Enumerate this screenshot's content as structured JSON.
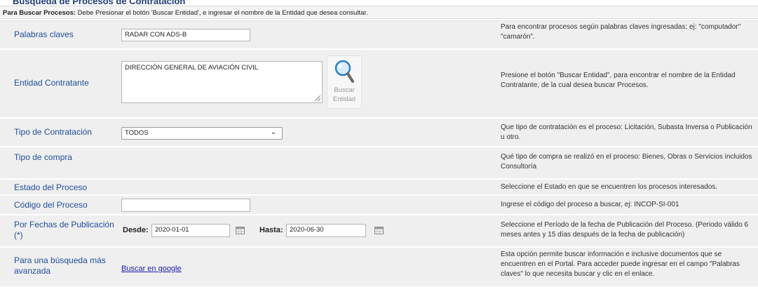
{
  "page_title": "Búsqueda de Procesos de Contratación",
  "instructions": {
    "bold": "Para Buscar Procesos:",
    "text": " Debe Presionar el botón 'Buscar Entidad', e ingresar el nombre de la Entidad que desea consultar."
  },
  "rows": {
    "keywords": {
      "label": "Palabras claves",
      "value": "RADAR CON  ADS-B",
      "help": "Para encontrar procesos según palabras claves ingresadas; ej: \"computador\" \"camarón\"."
    },
    "entity": {
      "label": "Entidad Contratante",
      "value": "DIRECCIÓN GENERAL DE AVIACIÓN CIVIL",
      "button_line1": "Buscar",
      "button_line2": "Entidad",
      "help": "Presione el botón \"Buscar Entidad\", para encontrar el nombre de la Entidad Contratante, de la cual desea buscar Procesos."
    },
    "contract_type": {
      "label": "Tipo de Contratación",
      "selected": "TODOS",
      "help": "Que tipo de contratación es el proceso: Licitación, Subasta Inversa o Publicación u otro."
    },
    "purchase_type": {
      "label": "Tipo de compra",
      "help": "Qué tipo de compra se realizó en el proceso: Bienes, Obras o Servicios incluidos Consultoría"
    },
    "status": {
      "label": "Estado del Proceso",
      "help": "Seleccione el Estado en que se encuentren los procesos interesados."
    },
    "code": {
      "label": "Código del Proceso",
      "value": "",
      "help": "Ingrese el código del proceso a buscar, ej: INCOP-SI-001"
    },
    "dates": {
      "label": "Por Fechas de Publicación (*)",
      "from_label": "Desde:",
      "from_value": "2020-01-01",
      "to_label": "Hasta:",
      "to_value": "2020-06-30",
      "help": "Seleccione el Período de la fecha de Publicación del Proceso. (Periodo válido 6 meses antes y 15 días después de la fecha de publicación)"
    },
    "advanced": {
      "label": "Para una búsqueda más avanzada",
      "link": "Buscar en google",
      "help": "Esta opción permite buscar información e inclusive documentos que se encuentren en el Portal. Para acceder puede ingresar en el campo \"Palabras claves\" lo que necesita buscar y clic en el enlace."
    }
  },
  "colors": {
    "label": "#1f4e9a",
    "row_bg": "#efefef",
    "link": "#1a1aa6"
  },
  "icons": [
    "search-magnifier-icon",
    "calendar-icon",
    "chevron-down-icon"
  ]
}
